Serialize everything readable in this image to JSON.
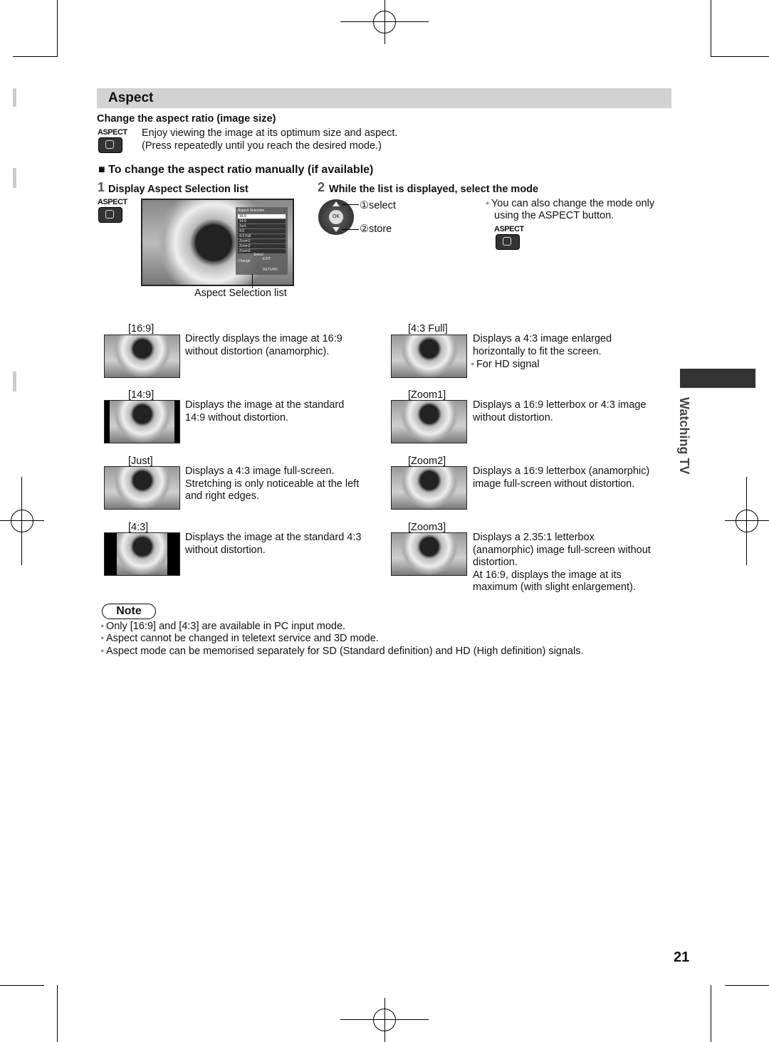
{
  "section_title": "Aspect",
  "change_heading": "Change the aspect ratio (image size)",
  "button_label": "ASPECT",
  "intro_lines": [
    "Enjoy viewing the image at its optimum size and aspect.",
    "(Press repeatedly until you reach the desired mode.)"
  ],
  "manual_heading": "■ To change the aspect ratio manually (if available)",
  "step1": {
    "num": "1",
    "text": "Display Aspect Selection list",
    "caption": "Aspect Selection list",
    "menu": {
      "title": "Aspect Selection",
      "items": [
        "16:9",
        "14:9",
        "Just",
        "4:3",
        "4:3 Full",
        "Zoom1",
        "Zoom2",
        "Zoom3"
      ],
      "select": "Select",
      "change": "Change",
      "exit": "EXIT",
      "return": "RETURN"
    }
  },
  "step2": {
    "num": "2",
    "text": "While the list is displayed, select the mode",
    "select": "①select",
    "store": "②store",
    "ok": "OK",
    "note_lines": [
      "You can also change the mode only",
      "using the ASPECT button."
    ]
  },
  "modes": [
    {
      "label": "[16:9]",
      "lines": [
        "Directly displays the image at 16:9",
        "without distortion (anamorphic)."
      ]
    },
    {
      "label": "[4:3 Full]",
      "lines": [
        "Displays a 4:3 image enlarged",
        "horizontally to fit the screen."
      ],
      "bullet": "For HD signal"
    },
    {
      "label": "[14:9]",
      "lines": [
        "Displays the image at the standard",
        "14:9 without distortion."
      ]
    },
    {
      "label": "[Zoom1]",
      "lines": [
        "Displays a 16:9 letterbox or 4:3 image",
        "without distortion."
      ]
    },
    {
      "label": "[Just]",
      "lines": [
        "Displays a 4:3 image full-screen.",
        "Stretching is only noticeable at the left",
        "and right edges."
      ]
    },
    {
      "label": "[Zoom2]",
      "lines": [
        "Displays a 16:9 letterbox (anamorphic)",
        "image full-screen without distortion."
      ]
    },
    {
      "label": "[4:3]",
      "lines": [
        "Displays the image at the standard 4:3",
        "without distortion."
      ]
    },
    {
      "label": "[Zoom3]",
      "lines": [
        "Displays a 2.35:1 letterbox",
        "(anamorphic) image full-screen without",
        "distortion.",
        "At 16:9, displays the image at its",
        "maximum (with slight enlargement)."
      ]
    }
  ],
  "note": {
    "label": "Note",
    "items": [
      "Only [16:9] and [4:3] are available in PC input mode.",
      "Aspect cannot be changed in teletext service and 3D mode.",
      "Aspect mode can be memorised separately for SD (Standard definition) and HD (High definition) signals."
    ]
  },
  "side_tab": "Watching TV",
  "page_number": "21"
}
